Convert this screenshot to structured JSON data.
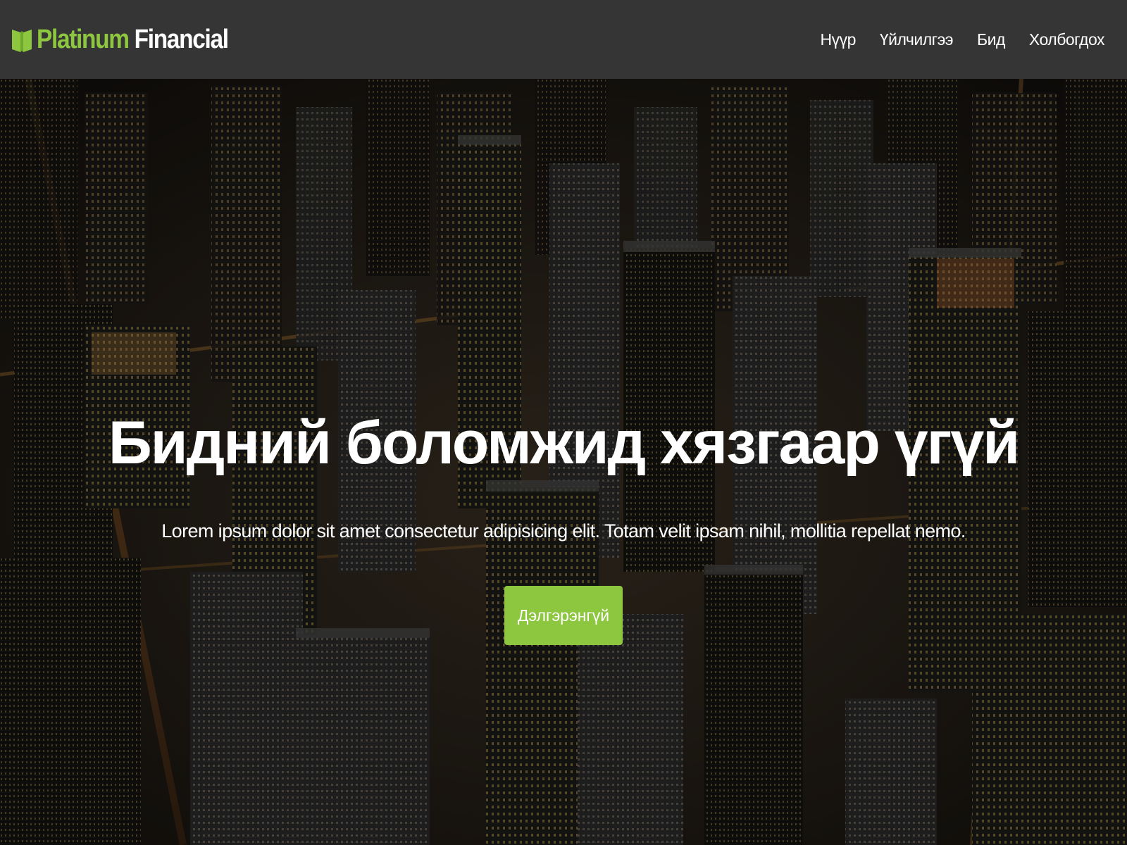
{
  "brand": {
    "name_part1": "Platinum",
    "name_part2": "Financial",
    "icon": "book-icon",
    "accent_color": "#8dc63f"
  },
  "nav": {
    "items": [
      {
        "label": "Нүүр"
      },
      {
        "label": "Үйлчилгээ"
      },
      {
        "label": "Бид"
      },
      {
        "label": "Холбогдох"
      }
    ]
  },
  "hero": {
    "background": "night city skyline aerial photo",
    "title": "Бидний боломжид хязгаар үгүй",
    "subtitle": "Lorem ipsum dolor sit amet consectetur adipisicing elit. Totam velit ipsam nihil, mollitia repellat nemo.",
    "cta_label": "Дэлгэрэнгүй"
  },
  "colors": {
    "navbar_bg": "#353535",
    "button_bg": "#8dc63f",
    "text": "#ffffff"
  }
}
